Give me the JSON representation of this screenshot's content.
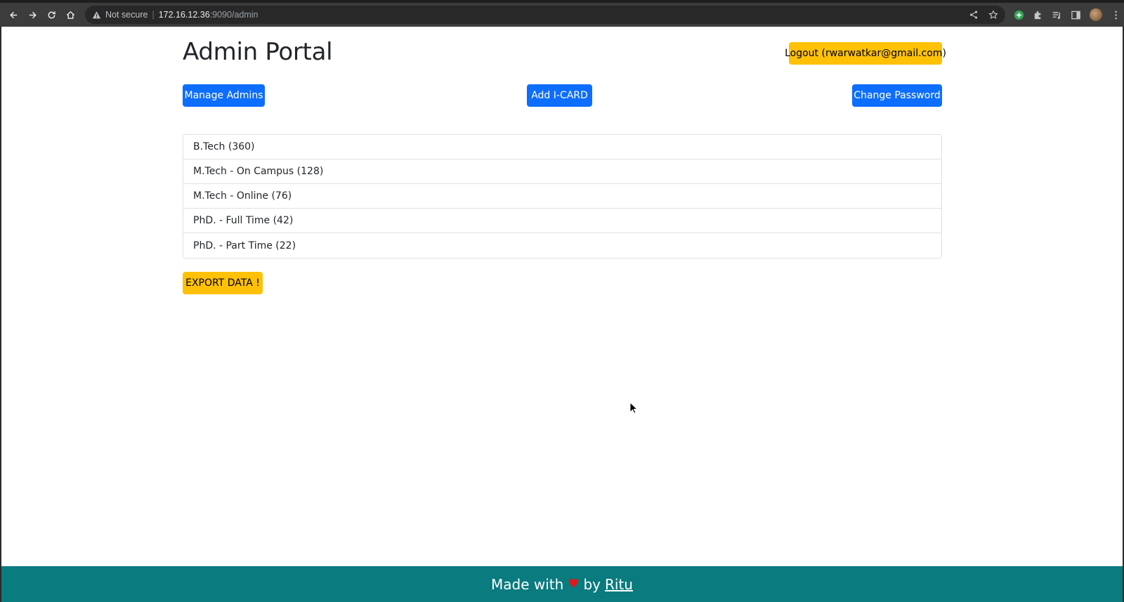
{
  "browser": {
    "security_label": "Not secure",
    "url_host": "172.16.12.36",
    "url_rest": ":9090/admin"
  },
  "header": {
    "title": "Admin Portal",
    "logout_label": "Logout (rwarwatkar@gmail.com)"
  },
  "actions": {
    "manage_admins": "Manage Admins",
    "add_icard": "Add I-CARD",
    "change_password": "Change Password"
  },
  "programs": [
    {
      "label": "B.Tech (360)"
    },
    {
      "label": "M.Tech - On Campus (128)"
    },
    {
      "label": "M.Tech - Online (76)"
    },
    {
      "label": "PhD. - Full Time (42)"
    },
    {
      "label": "PhD. - Part Time (22)"
    }
  ],
  "export_label": "EXPORT DATA !",
  "footer": {
    "made_with": "Made with",
    "heart": "♥",
    "by": "by",
    "author": "Ritu"
  },
  "colors": {
    "primary": "#0d6efd",
    "warning": "#ffc107",
    "footer_bg": "#0a7b7f",
    "heart": "#e0191a"
  }
}
